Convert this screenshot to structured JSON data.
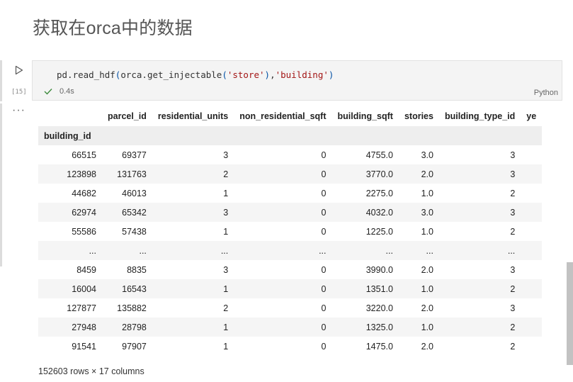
{
  "heading": "获取在orca中的数据",
  "cell": {
    "execution_count": "[15]",
    "code": {
      "t1": "pd.read_hdf",
      "t2": "(",
      "t3": "orca.get_injectable",
      "t4": "(",
      "t5": "'store'",
      "t6": ")",
      "t7": ",",
      "t8": "'building'",
      "t9": ")"
    },
    "status_time": "0.4s",
    "language": "Python",
    "more_label": "···"
  },
  "table": {
    "index_name": "building_id",
    "columns": [
      "parcel_id",
      "residential_units",
      "non_residential_sqft",
      "building_sqft",
      "stories",
      "building_type_id",
      "ye"
    ],
    "rows": [
      [
        "66515",
        "69377",
        "3",
        "0",
        "4755.0",
        "3.0",
        "3",
        ""
      ],
      [
        "123898",
        "131763",
        "2",
        "0",
        "3770.0",
        "2.0",
        "3",
        ""
      ],
      [
        "44682",
        "46013",
        "1",
        "0",
        "2275.0",
        "1.0",
        "2",
        ""
      ],
      [
        "62974",
        "65342",
        "3",
        "0",
        "4032.0",
        "3.0",
        "3",
        ""
      ],
      [
        "55586",
        "57438",
        "1",
        "0",
        "1225.0",
        "1.0",
        "2",
        ""
      ],
      [
        "...",
        "...",
        "...",
        "...",
        "...",
        "...",
        "...",
        ""
      ],
      [
        "8459",
        "8835",
        "3",
        "0",
        "3990.0",
        "2.0",
        "3",
        ""
      ],
      [
        "16004",
        "16543",
        "1",
        "0",
        "1351.0",
        "1.0",
        "2",
        ""
      ],
      [
        "127877",
        "135882",
        "2",
        "0",
        "3220.0",
        "2.0",
        "3",
        ""
      ],
      [
        "27948",
        "28798",
        "1",
        "0",
        "1325.0",
        "1.0",
        "2",
        ""
      ],
      [
        "91541",
        "97907",
        "1",
        "0",
        "1475.0",
        "2.0",
        "2",
        ""
      ]
    ],
    "shape": "152603 rows × 17 columns"
  },
  "colors": {
    "check": "#3c8a3c",
    "string": "#a31515",
    "paren": "#0451a5"
  }
}
